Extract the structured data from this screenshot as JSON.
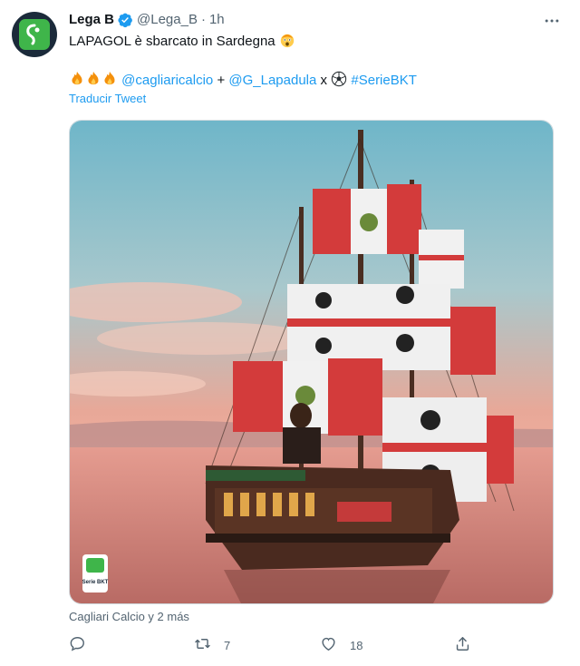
{
  "tweet": {
    "display_name": "Lega B",
    "handle": "@Lega_B",
    "separator": "·",
    "time": "1h",
    "text_line1": "LAPAGOL è sbarcato in Sardegna",
    "line2": {
      "mention1": "@cagliaricalcio",
      "plus": " + ",
      "mention2": "@G_Lapadula",
      "x": " x ",
      "hashtag": "#SerieBKT"
    },
    "translate_label": "Traducir Tweet",
    "tagged_label": "Cagliari Calcio y 2 más",
    "actions": {
      "reply_count": "",
      "retweet_count": "7",
      "like_count": "18"
    },
    "icons": {
      "avatar": "lega-b-logo",
      "verified": "verified-badge-icon",
      "more": "more-options-icon",
      "shock": "shocked-face-emoji",
      "fire": "fire-emoji",
      "ball": "soccer-ball-emoji",
      "reply": "reply-icon",
      "retweet": "retweet-icon",
      "like": "like-heart-icon",
      "share": "share-icon"
    },
    "media_logo_text": "Serie BKT",
    "colors": {
      "link": "#1d9bf0",
      "secondary": "#536471",
      "text": "#0f1419"
    }
  }
}
